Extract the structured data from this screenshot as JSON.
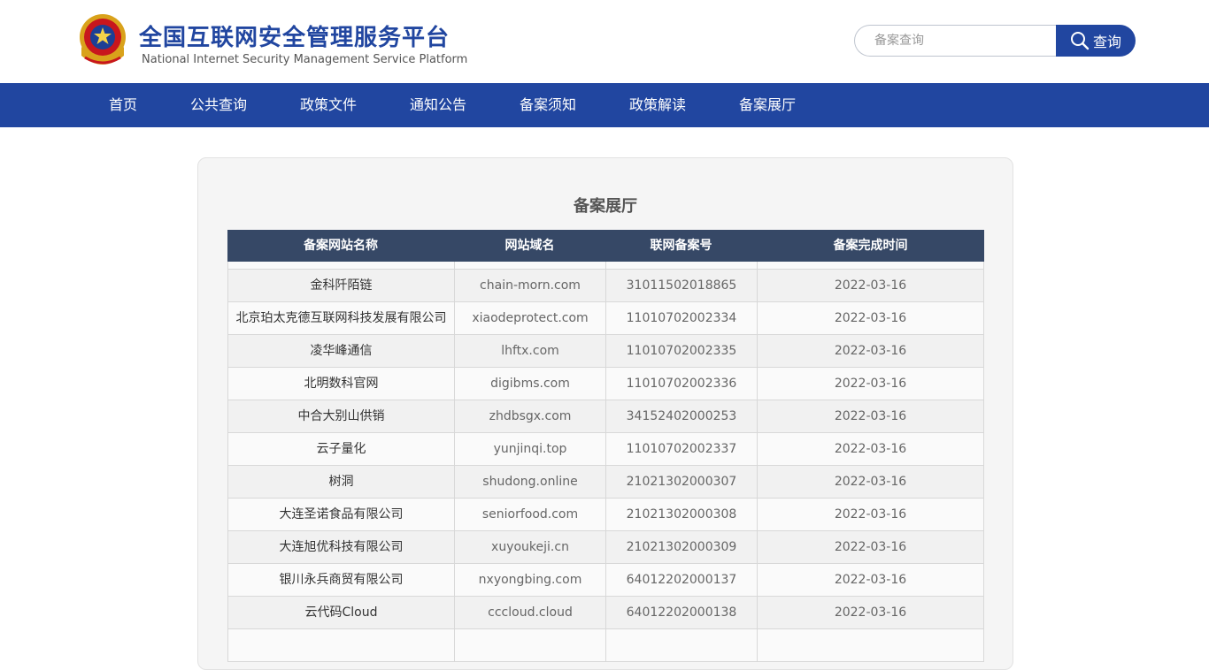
{
  "header": {
    "title": "全国互联网安全管理服务平台",
    "subtitle": "National Internet Security Management Service Platform",
    "emblem_icon": "police-emblem-icon"
  },
  "search": {
    "placeholder": "备案查询",
    "value": "",
    "button_label": "查询",
    "button_icon": "search-icon"
  },
  "nav": {
    "items": [
      {
        "label": "首页"
      },
      {
        "label": "公共查询"
      },
      {
        "label": "政策文件"
      },
      {
        "label": "通知公告"
      },
      {
        "label": "备案须知"
      },
      {
        "label": "政策解读"
      },
      {
        "label": "备案展厅"
      }
    ]
  },
  "main": {
    "title": "备案展厅",
    "table": {
      "columns": [
        "备案网站名称",
        "网站域名",
        "联网备案号",
        "备案完成时间"
      ],
      "rows": [
        [
          "",
          "",
          "",
          ""
        ],
        [
          "金科阡陌链",
          "chain-morn.com",
          "31011502018865",
          "2022-03-16"
        ],
        [
          "北京珀太克德互联网科技发展有限公司",
          "xiaodeprotect.com",
          "11010702002334",
          "2022-03-16"
        ],
        [
          "凌华峰通信",
          "lhftx.com",
          "11010702002335",
          "2022-03-16"
        ],
        [
          "北明数科官网",
          "digibms.com",
          "11010702002336",
          "2022-03-16"
        ],
        [
          "中合大别山供销",
          "zhdbsgx.com",
          "34152402000253",
          "2022-03-16"
        ],
        [
          "云子量化",
          "yunjinqi.top",
          "11010702002337",
          "2022-03-16"
        ],
        [
          "树洞",
          "shudong.online",
          "21021302000307",
          "2022-03-16"
        ],
        [
          "大连圣诺食品有限公司",
          "seniorfood.com",
          "21021302000308",
          "2022-03-16"
        ],
        [
          "大连旭优科技有限公司",
          "xuyoukeji.cn",
          "21021302000309",
          "2022-03-16"
        ],
        [
          "银川永兵商贸有限公司",
          "nxyongbing.com",
          "64012202000137",
          "2022-03-16"
        ],
        [
          "云代码Cloud",
          "cccloud.cloud",
          "64012202000138",
          "2022-03-16"
        ],
        [
          "",
          "",
          "",
          ""
        ]
      ]
    }
  },
  "colors": {
    "brand_blue": "#2146a0",
    "table_header": "#364866"
  }
}
